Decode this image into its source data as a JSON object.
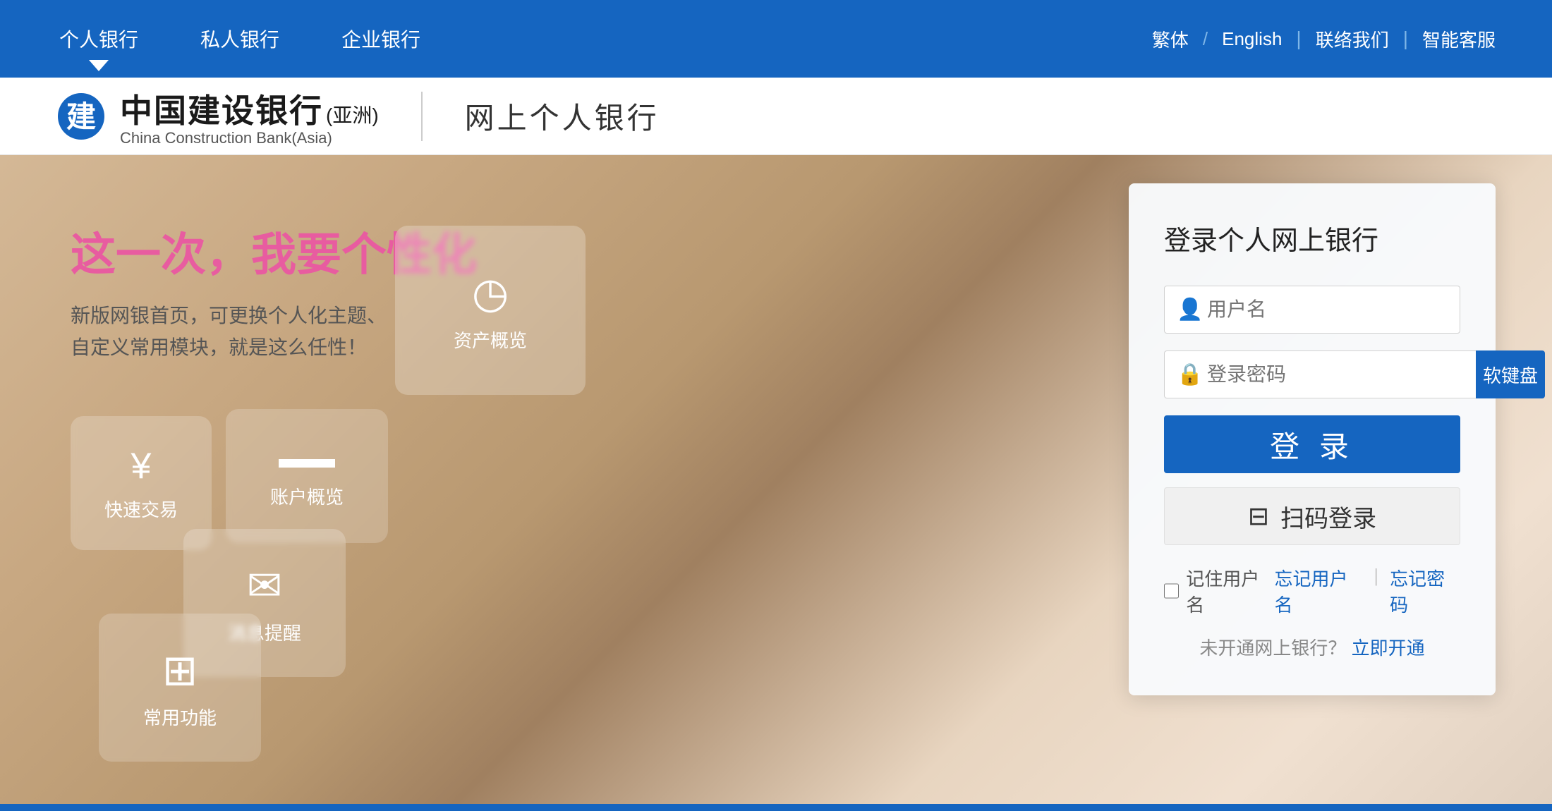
{
  "topnav": {
    "items": [
      {
        "label": "个人银行",
        "active": true
      },
      {
        "label": "私人银行",
        "active": false
      },
      {
        "label": "企业银行",
        "active": false
      }
    ],
    "right": {
      "traditional": "繁体",
      "slash": "/",
      "english": "English",
      "divider1": "|",
      "contact": "联络我们",
      "divider2": "|",
      "service": "智能客服"
    }
  },
  "logobar": {
    "bank_name_cn": "中国建设银行",
    "bank_asia": "(亚洲)",
    "bank_name_en": "China Construction Bank(Asia)",
    "subtitle": "网上个人银行"
  },
  "hero": {
    "promo_title": "这一次，我要个性化",
    "promo_subtitle": "新版网银首页，可更换个人化主题、\n自定义常用模块，就是这么任性！",
    "features": [
      {
        "id": "asset",
        "icon": "◷",
        "label": "资产概览"
      },
      {
        "id": "quick",
        "icon": "¥",
        "label": "快速交易"
      },
      {
        "id": "account",
        "icon": "▬",
        "label": "账户概览"
      },
      {
        "id": "message",
        "icon": "✉",
        "label": "消息提醒"
      },
      {
        "id": "common",
        "icon": "⊞",
        "label": "常用功能"
      }
    ]
  },
  "login": {
    "title": "登录个人网上银行",
    "username_placeholder": "用户名",
    "password_placeholder": "登录密码",
    "soft_keyboard": "软键盘",
    "login_btn": "登 录",
    "qr_login": "扫码登录",
    "remember_me": "记住用户名",
    "forgot_username": "忘记用户名",
    "forgot_password": "忘记密码",
    "register_prompt": "未开通网上银行？",
    "register_link": "立即开通"
  }
}
